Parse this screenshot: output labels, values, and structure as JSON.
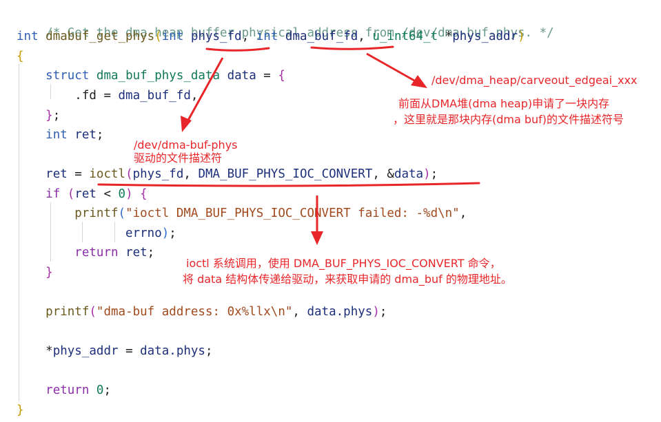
{
  "code": {
    "l1_comment": "/* Get the dma-heap buffer physical address from /dev/dma-buf-phys. */",
    "l2_kw1": "int",
    "l2_fn": "dmabuf_get_phys",
    "l2_p1": "(",
    "l2_kw2": "int",
    "l2_param1": "phys_fd",
    "l2_comma1": ", ",
    "l2_kw3": "int",
    "l2_param2": "dma_buf_fd",
    "l2_comma2": ", ",
    "l2_type": "u_int64_t",
    "l2_star": " *",
    "l2_param3": "phys_addr",
    "l2_p2": ")",
    "l3_brace": "{",
    "l4_kw": "struct",
    "l4_type": "dma_buf_phys_data",
    "l4_var": "data",
    "l4_eq": " = ",
    "l4_brace": "{",
    "l5_field": ".fd",
    "l5_eq": " = ",
    "l5_val": "dma_buf_fd",
    "l5_comma": ",",
    "l6_brace": "}",
    "l6_semi": ";",
    "l7_kw": "int",
    "l7_var": "ret",
    "l7_semi": ";",
    "l9_var": "ret",
    "l9_eq": " = ",
    "l9_fn": "ioctl",
    "l9_p1": "(",
    "l9_arg1": "phys_fd",
    "l9_comma1": ", ",
    "l9_macro": "DMA_BUF_PHYS_IOC_CONVERT",
    "l9_comma2": ", &",
    "l9_arg3": "data",
    "l9_p2": ")",
    "l9_semi": ";",
    "l10_kw": "if",
    "l10_p1": " (",
    "l10_var": "ret",
    "l10_lt": " < ",
    "l10_num": "0",
    "l10_p2": ")",
    "l10_brace": "{",
    "l11_fn": "printf",
    "l11_p1": "(",
    "l11_str": "\"ioctl DMA_BUF_PHYS_IOC_CONVERT failed: -%d\\n\"",
    "l11_comma": ",",
    "l12_var": "errno",
    "l12_p2": ")",
    "l12_semi": ";",
    "l13_kw": "return",
    "l13_var": "ret",
    "l13_semi": ";",
    "l14_brace": "}",
    "l16_fn": "printf",
    "l16_p1": "(",
    "l16_str": "\"dma-buf address: 0x%llx\\n\"",
    "l16_comma": ", ",
    "l16_var": "data.phys",
    "l16_p2": ")",
    "l16_semi": ";",
    "l18_star": "*",
    "l18_var": "phys_addr",
    "l18_eq": " = ",
    "l18_val": "data.phys",
    "l18_semi": ";",
    "l20_kw": "return",
    "l20_num": "0",
    "l20_semi": ";",
    "l21_brace": "}"
  },
  "annotations": {
    "heap_path": "/dev/dma_heap/carveout_edgeai_xxx",
    "dma_buf_line1": "前面从DMA堆(dma heap)申请了一块内存",
    "dma_buf_line2": "，这里就是那块内存(dma buf)的文件描述符号",
    "phys_path": "/dev/dma-buf-phys",
    "phys_desc": "驱动的文件描述符",
    "ioctl_line1": "ioctl 系统调用，使用 DMA_BUF_PHYS_IOC_CONVERT 命令，",
    "ioctl_line2": "将 data 结构体传递给驱动，来获取申请的 dma_buf 的物理地址。"
  },
  "colors": {
    "annotation_red": "#e8262a",
    "keyword_blue": "#2f5fb3",
    "comment_green": "#6a9a8a"
  }
}
